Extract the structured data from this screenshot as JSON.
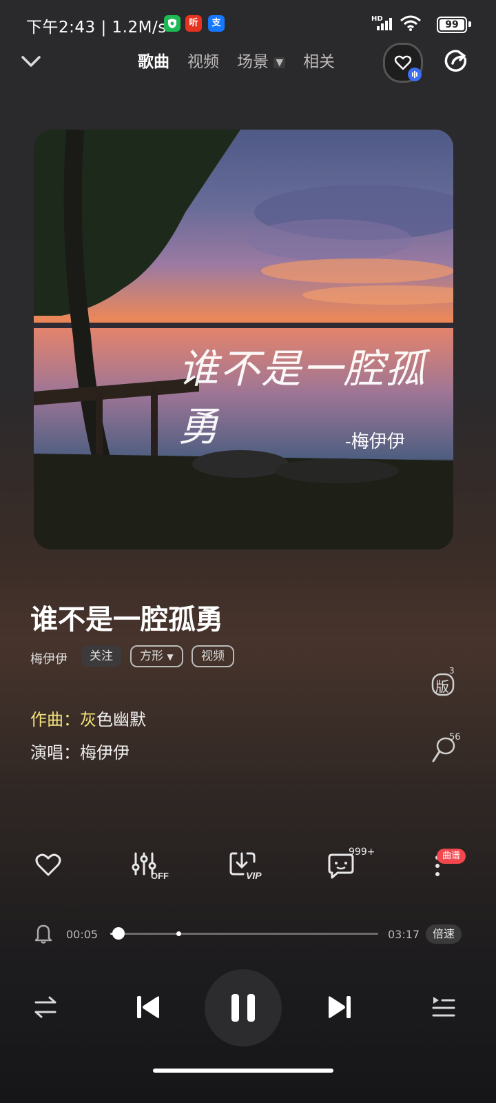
{
  "status_bar": {
    "time": "下午2:43",
    "net_speed": "1.2M/s",
    "app_badge_listen": "听",
    "app_badge_alipay": "支",
    "signal": "HD",
    "battery": "99"
  },
  "nav": {
    "tabs": [
      {
        "label": "歌曲",
        "active": true
      },
      {
        "label": "视频",
        "active": false
      },
      {
        "label": "场景",
        "active": false
      },
      {
        "label": "相关",
        "active": false
      }
    ]
  },
  "cover": {
    "calligraphy": "谁不是一腔孤勇",
    "signature": "-梅伊伊"
  },
  "song": {
    "title": "谁不是一腔孤勇",
    "artist": "梅伊伊",
    "follow_label": "关注",
    "style_label": "方形",
    "video_label": "视频",
    "composer_prefix": "作曲：",
    "composer_highlight": "灰",
    "composer_rest": "色幽默",
    "singer_line": "演唱：梅伊伊"
  },
  "side_badges": {
    "versions_label": "版",
    "versions_count": "3",
    "sing_count": "56"
  },
  "actions": {
    "comments_count": "999+",
    "score_badge": "曲谱"
  },
  "player": {
    "elapsed": "00:05",
    "duration": "03:17",
    "progress": 0.03,
    "speed_label": "倍速"
  },
  "colors": {
    "highlight": "#f3e37c",
    "badge_red": "#f2474e"
  }
}
